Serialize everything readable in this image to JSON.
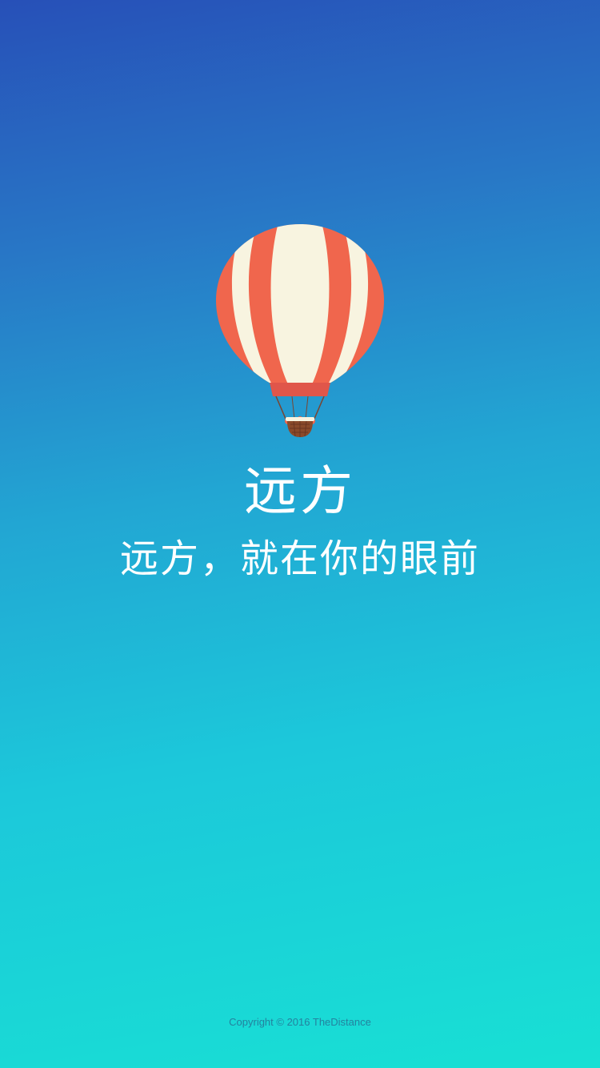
{
  "app": {
    "name": "远方",
    "slogan": "远方，就在你的眼前"
  },
  "footer": {
    "copyright": "Copyright © 2016 TheDistance"
  },
  "icons": {
    "logo": "hot-air-balloon-icon"
  },
  "colors": {
    "gradient_top": "#2750b8",
    "gradient_bottom": "#18e0d4",
    "balloon_stripe_red": "#f0664d",
    "balloon_stripe_cream": "#f8f4e0",
    "basket_brown": "#8a4a2a"
  }
}
